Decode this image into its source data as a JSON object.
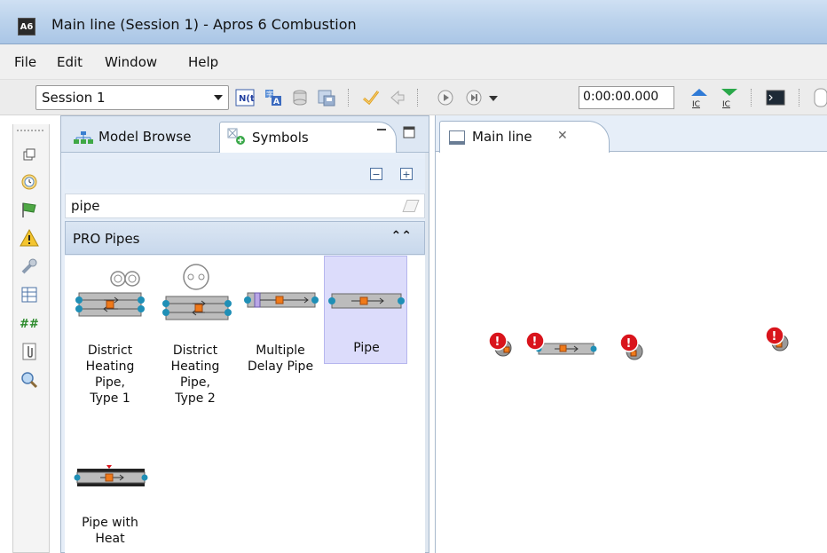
{
  "window": {
    "app_icon": "A6",
    "title": "Main line (Session 1) - Apros 6 Combustion"
  },
  "menu": {
    "items": [
      {
        "label": "File"
      },
      {
        "label": "Edit"
      },
      {
        "label": "Window"
      },
      {
        "label": "Help"
      }
    ]
  },
  "toolbar": {
    "session_value": "Session 1",
    "time_value": "0:00:00.000",
    "icons": [
      "nl-toggle-icon",
      "translate-icon",
      "database-icon",
      "save-db-icon",
      "check-icon",
      "arrow-icon",
      "play-icon",
      "step-icon",
      "dropdown-icon",
      "ic-up-icon",
      "ic-down-icon",
      "console-icon"
    ],
    "ic_label": "IC"
  },
  "left_strip": {
    "icons": [
      "restore-icon",
      "clock-icon",
      "flag-icon",
      "warning-icon",
      "wrench-icon",
      "table-icon",
      "hash-icon",
      "clip-icon",
      "search-icon"
    ],
    "hash_label": "##"
  },
  "browser_panel": {
    "tabs": [
      {
        "label": "Model Browse"
      },
      {
        "label": "Symbols"
      }
    ],
    "search_value": "pipe",
    "section_title": "PRO Pipes",
    "items": [
      {
        "label": "District\nHeating\nPipe,\nType 1",
        "selected": false
      },
      {
        "label": "District\nHeating\nPipe,\nType 2",
        "selected": false
      },
      {
        "label": "Multiple\nDelay Pipe",
        "selected": false
      },
      {
        "label": "Pipe",
        "selected": true
      },
      {
        "label": "Pipe with\nHeat",
        "selected": false
      }
    ]
  },
  "editor": {
    "tab_label": "Main line"
  },
  "colors": {
    "titlebar": "#bcd3ec",
    "selection": "#dcdcfb",
    "error_red": "#d9141c",
    "port_teal": "#1f8fb6",
    "node_orange": "#f07a1a"
  }
}
